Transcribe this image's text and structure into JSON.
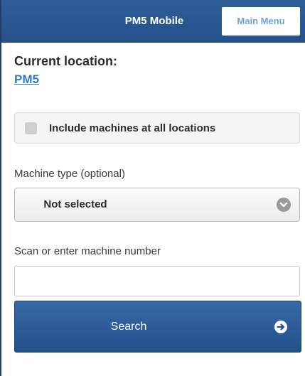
{
  "header": {
    "title": "PM5 Mobile",
    "main_menu_label": "Main Menu"
  },
  "location": {
    "label": "Current location:",
    "value": "PM5"
  },
  "include_all": {
    "label": "Include machines at all locations",
    "checked": false
  },
  "machine_type": {
    "label": "Machine type (optional)",
    "selected": "Not selected",
    "icon": "chevron-down-icon"
  },
  "machine_number": {
    "label": "Scan or enter machine number",
    "value": ""
  },
  "search": {
    "label": "Search",
    "icon": "arrow-right-icon"
  },
  "colors": {
    "header_bg": "#2a5791",
    "link": "#2e7cc7",
    "main_menu_text": "#6fa2d8"
  }
}
